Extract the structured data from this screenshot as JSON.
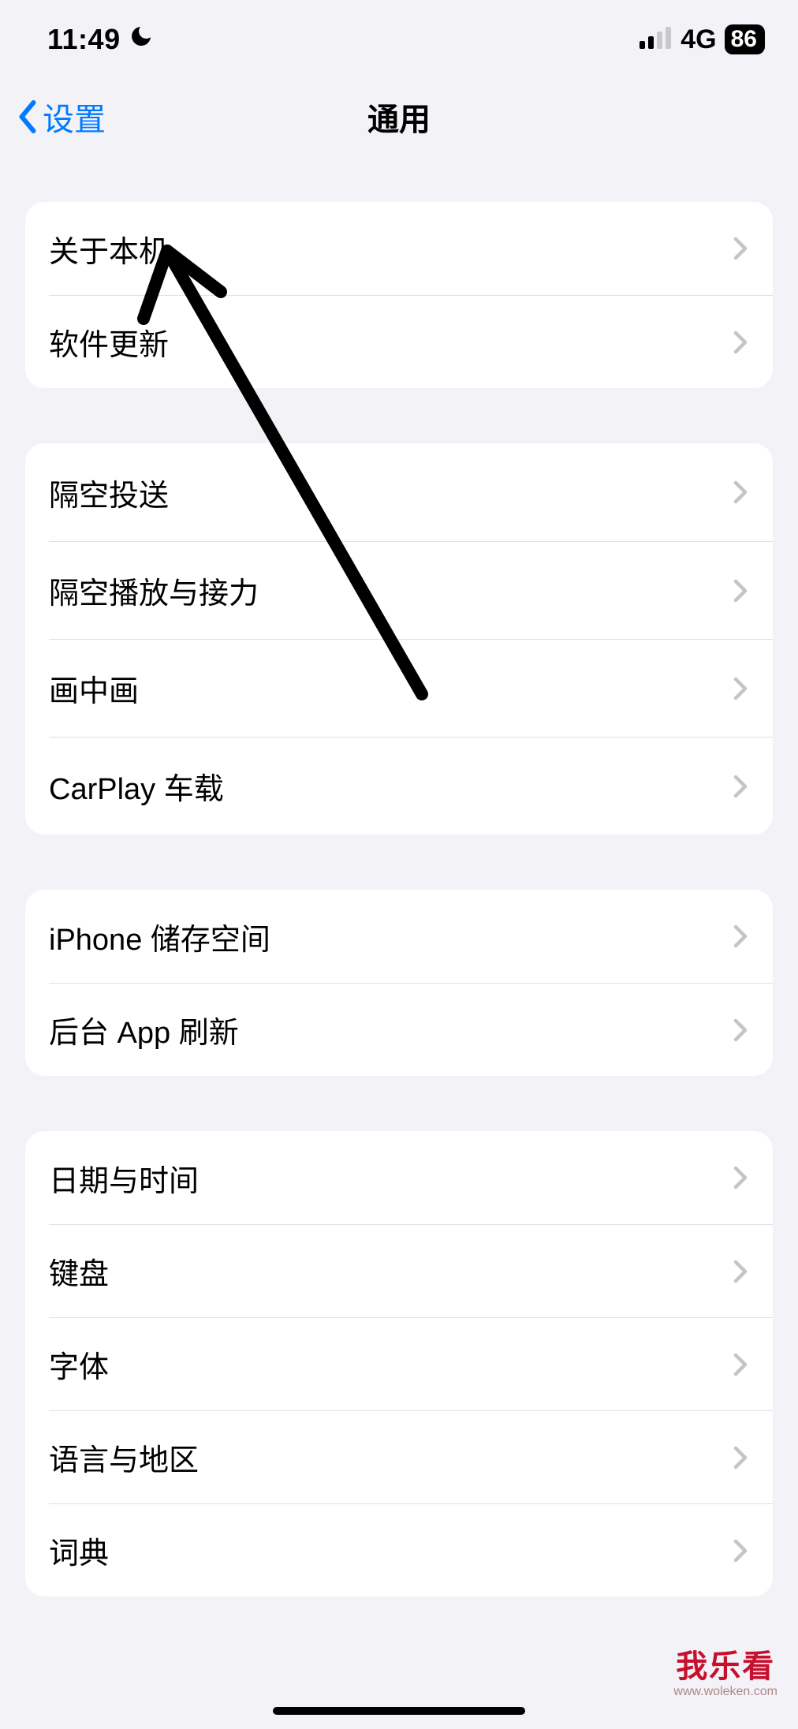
{
  "status": {
    "time": "11:49",
    "dnd_icon": "moon",
    "cellular_label": "4G",
    "battery_percent": "86"
  },
  "nav": {
    "back_label": "设置",
    "title": "通用"
  },
  "groups": [
    {
      "rows": [
        {
          "id": "about",
          "label": "关于本机"
        },
        {
          "id": "software-update",
          "label": "软件更新"
        }
      ]
    },
    {
      "rows": [
        {
          "id": "airdrop",
          "label": "隔空投送"
        },
        {
          "id": "airplay",
          "label": "隔空播放与接力"
        },
        {
          "id": "pip",
          "label": "画中画"
        },
        {
          "id": "carplay",
          "label": "CarPlay 车载"
        }
      ]
    },
    {
      "rows": [
        {
          "id": "storage",
          "label": "iPhone 储存空间"
        },
        {
          "id": "bg-refresh",
          "label": "后台 App 刷新"
        }
      ]
    },
    {
      "rows": [
        {
          "id": "date-time",
          "label": "日期与时间"
        },
        {
          "id": "keyboard",
          "label": "键盘"
        },
        {
          "id": "fonts",
          "label": "字体"
        },
        {
          "id": "lang-region",
          "label": "语言与地区"
        },
        {
          "id": "dictionary",
          "label": "词典"
        }
      ]
    }
  ],
  "watermark": {
    "main": "我乐看",
    "sub": "www.woleken.com"
  }
}
